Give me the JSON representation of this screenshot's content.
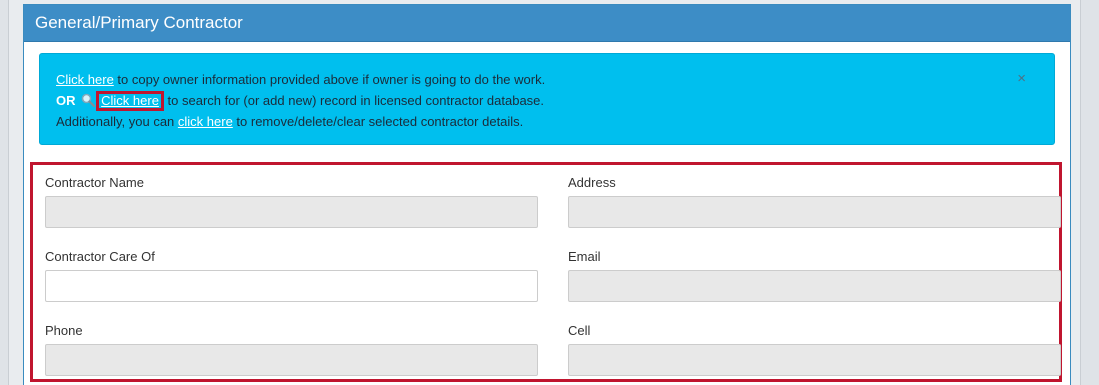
{
  "panel": {
    "title": "General/Primary Contractor"
  },
  "alert": {
    "line1_link": "Click here",
    "line1_text": " to copy owner information provided above if owner is going to do the work.",
    "line2_or": "OR",
    "line2_link": "Click here",
    "line2_text": "to search for (or add new) record in licensed contractor database.",
    "line3_prefix": "Additionally, you can ",
    "line3_link": "click here",
    "line3_text": " to remove/delete/clear selected contractor details.",
    "close_symbol": "×"
  },
  "form": {
    "contractor_name": {
      "label": "Contractor Name",
      "value": ""
    },
    "address": {
      "label": "Address",
      "value": ""
    },
    "contractor_care_of": {
      "label": "Contractor Care Of",
      "value": ""
    },
    "email": {
      "label": "Email",
      "value": ""
    },
    "phone": {
      "label": "Phone",
      "value": ""
    },
    "cell": {
      "label": "Cell",
      "value": ""
    }
  },
  "colors": {
    "header_blue": "#3d8dc6",
    "alert_cyan": "#00bfee",
    "highlight_red": "#c0152f",
    "readonly_gray": "#e8e8e8"
  },
  "icons": {
    "search": "search-icon",
    "close": "close-icon"
  }
}
